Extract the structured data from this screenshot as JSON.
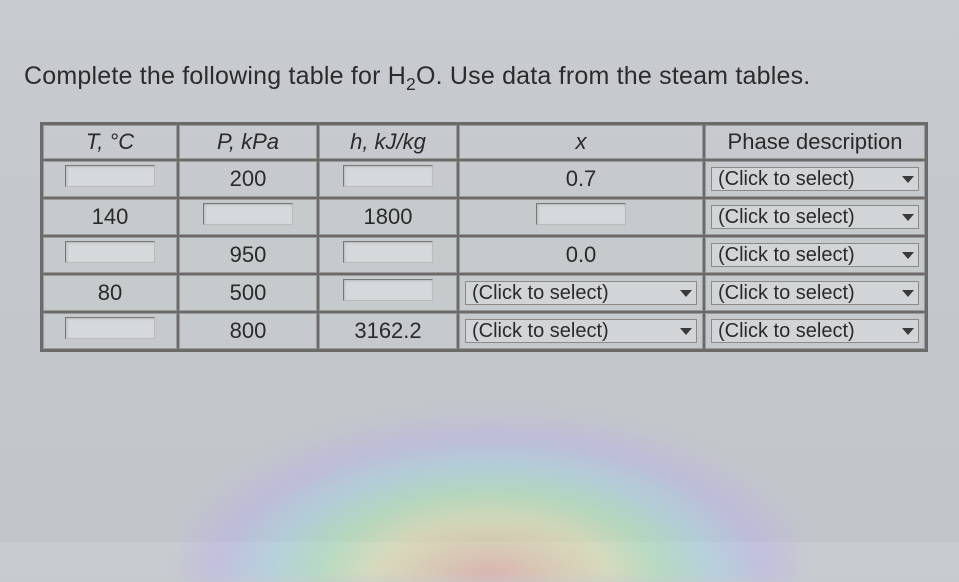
{
  "prompt": {
    "pre": "Complete the following table for H",
    "sub": "2",
    "post": "O. Use data from the steam tables."
  },
  "headers": {
    "T": "T, °C",
    "P": "P, kPa",
    "h": "h, kJ/kg",
    "x": "x",
    "phase": "Phase description"
  },
  "rows": [
    {
      "T": {
        "type": "input",
        "value": ""
      },
      "P": {
        "type": "text",
        "value": "200"
      },
      "h": {
        "type": "input",
        "value": ""
      },
      "x": {
        "type": "text",
        "value": "0.7"
      },
      "phase": {
        "type": "select",
        "value": "(Click to select)"
      }
    },
    {
      "T": {
        "type": "text",
        "value": "140"
      },
      "P": {
        "type": "input",
        "value": ""
      },
      "h": {
        "type": "text",
        "value": "1800"
      },
      "x": {
        "type": "input",
        "value": ""
      },
      "phase": {
        "type": "select",
        "value": "(Click to select)"
      }
    },
    {
      "T": {
        "type": "input",
        "value": ""
      },
      "P": {
        "type": "text",
        "value": "950"
      },
      "h": {
        "type": "input",
        "value": ""
      },
      "x": {
        "type": "text",
        "value": "0.0"
      },
      "phase": {
        "type": "select",
        "value": "(Click to select)"
      }
    },
    {
      "T": {
        "type": "text",
        "value": "80"
      },
      "P": {
        "type": "text",
        "value": "500"
      },
      "h": {
        "type": "input",
        "value": ""
      },
      "x": {
        "type": "select",
        "value": "(Click to select)"
      },
      "phase": {
        "type": "select",
        "value": "(Click to select)"
      }
    },
    {
      "T": {
        "type": "input",
        "value": ""
      },
      "P": {
        "type": "text",
        "value": "800"
      },
      "h": {
        "type": "text",
        "value": "3162.2"
      },
      "x": {
        "type": "select",
        "value": "(Click to select)"
      },
      "phase": {
        "type": "select",
        "value": "(Click to select)"
      }
    }
  ],
  "chart_data": {
    "type": "table",
    "title": "H2O property table (steam tables exercise)",
    "columns": [
      "T, °C",
      "P, kPa",
      "h, kJ/kg",
      "x",
      "Phase description"
    ],
    "rows": [
      [
        "",
        "200",
        "",
        "0.7",
        "(Click to select)"
      ],
      [
        "140",
        "",
        "1800",
        "",
        "(Click to select)"
      ],
      [
        "",
        "950",
        "",
        "0.0",
        "(Click to select)"
      ],
      [
        "80",
        "500",
        "",
        "(Click to select)",
        "(Click to select)"
      ],
      [
        "",
        "800",
        "3162.2",
        "(Click to select)",
        "(Click to select)"
      ]
    ]
  }
}
